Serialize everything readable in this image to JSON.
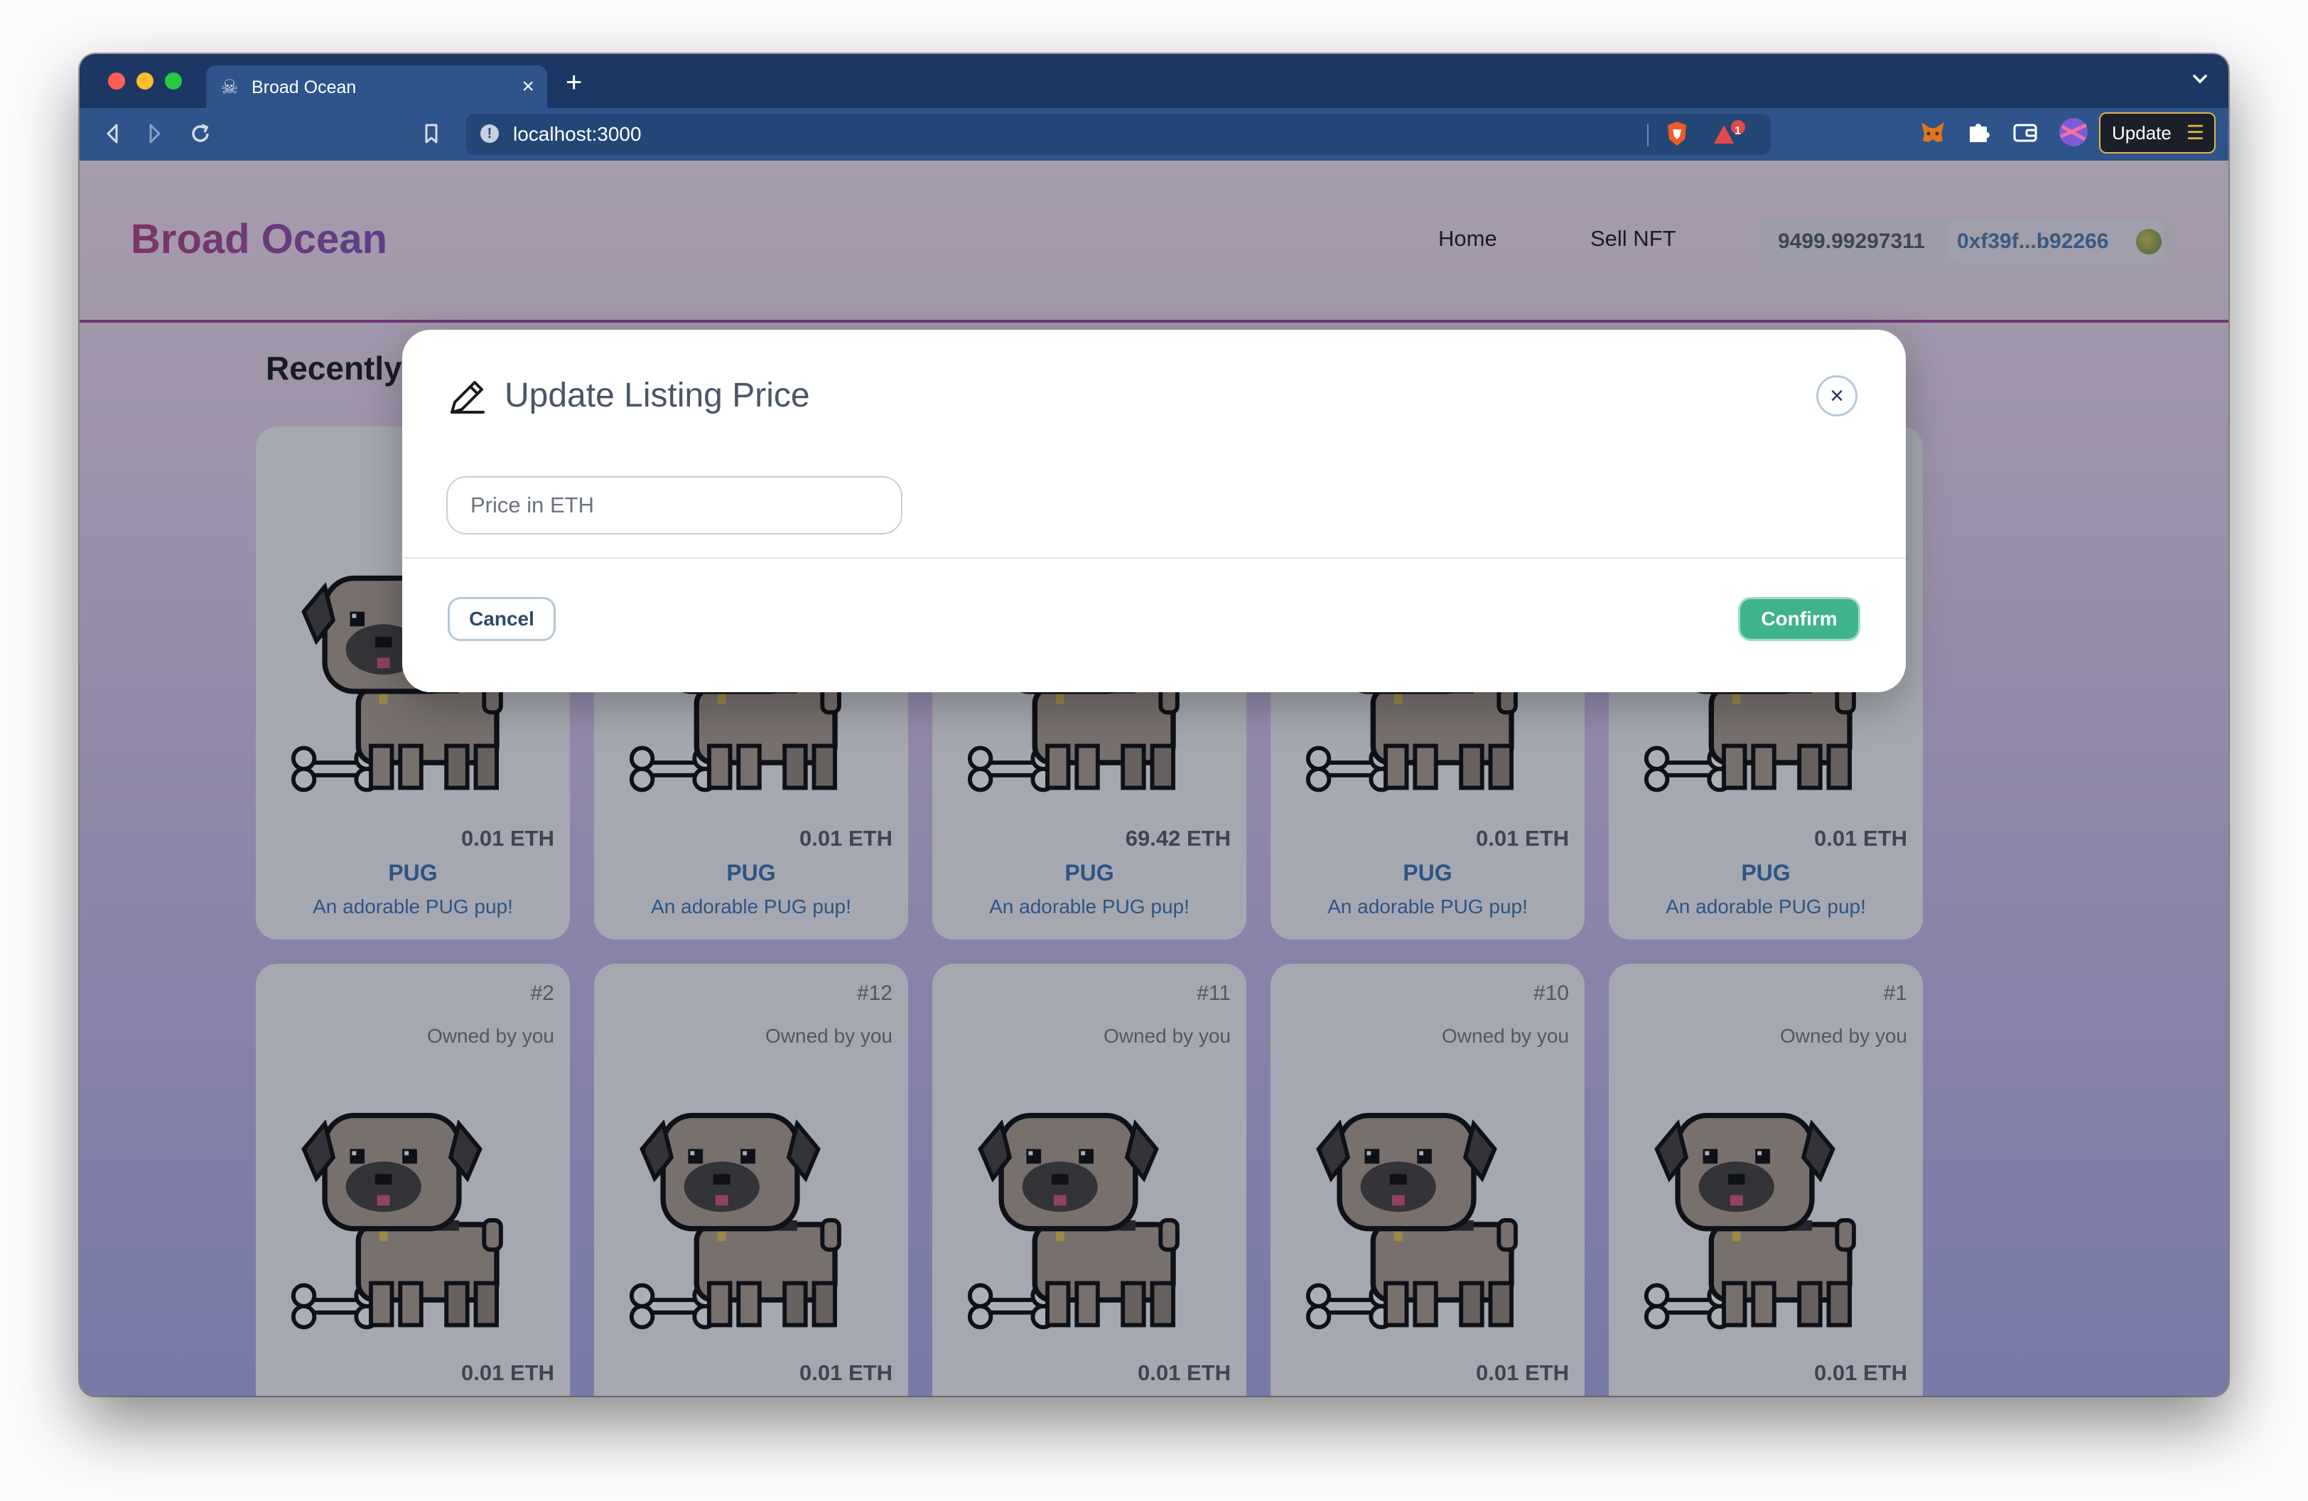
{
  "browser": {
    "tab_title": "Broad Ocean",
    "url": "localhost:3000",
    "update_label": "Update",
    "shield_badge": "1",
    "traffic_colors": [
      "#ff5f57",
      "#febc2e",
      "#28c840"
    ]
  },
  "site": {
    "brand": "Broad Ocean",
    "nav": [
      "Home",
      "Sell NFT"
    ],
    "wallet_balance": "9499.99297311",
    "wallet_address": "0xf39f...b92266",
    "section_heading": "Recently Listed"
  },
  "cards_row1": [
    {
      "price": "0.01 ETH",
      "name": "PUG",
      "description": "An adorable PUG pup!"
    },
    {
      "price": "0.01 ETH",
      "name": "PUG",
      "description": "An adorable PUG pup!"
    },
    {
      "price": "69.42 ETH",
      "name": "PUG",
      "description": "An adorable PUG pup!"
    },
    {
      "price": "0.01 ETH",
      "name": "PUG",
      "description": "An adorable PUG pup!"
    },
    {
      "price": "0.01 ETH",
      "name": "PUG",
      "description": "An adorable PUG pup!"
    }
  ],
  "cards_row2": [
    {
      "number": "#2",
      "owner": "Owned by you",
      "price": "0.01 ETH"
    },
    {
      "number": "#12",
      "owner": "Owned by you",
      "price": "0.01 ETH"
    },
    {
      "number": "#11",
      "owner": "Owned by you",
      "price": "0.01 ETH"
    },
    {
      "number": "#10",
      "owner": "Owned by you",
      "price": "0.01 ETH"
    },
    {
      "number": "#1",
      "owner": "Owned by you",
      "price": "0.01 ETH"
    }
  ],
  "modal": {
    "title": "Update Listing Price",
    "input_placeholder": "Price in ETH",
    "input_value": "",
    "cancel_label": "Cancel",
    "confirm_label": "Confirm",
    "close_glyph": "×"
  },
  "icons": {
    "tab_favicon": "jolly-roger-icon",
    "back": "back-icon",
    "forward": "forward-icon",
    "reload": "reload-icon",
    "bookmark": "bookmark-icon",
    "site_info": "info-icon",
    "brave_shield": "lion-shield-icon",
    "brave_rewards": "triangle-icon",
    "metamask": "fox-icon",
    "extensions": "puzzle-icon",
    "wallet": "wallet-icon",
    "profile": "profile-icon",
    "modal_title": "pencil-icon"
  },
  "colors": {
    "chrome": "#2e548b",
    "chrome_dark": "#1c3763",
    "brand_gradient": [
      "#b03a7a",
      "#7c4bb8"
    ],
    "accent_rule": "#a13b9d",
    "confirm_green": "#3fb48a",
    "card_text_blue": "#2f6fae"
  }
}
